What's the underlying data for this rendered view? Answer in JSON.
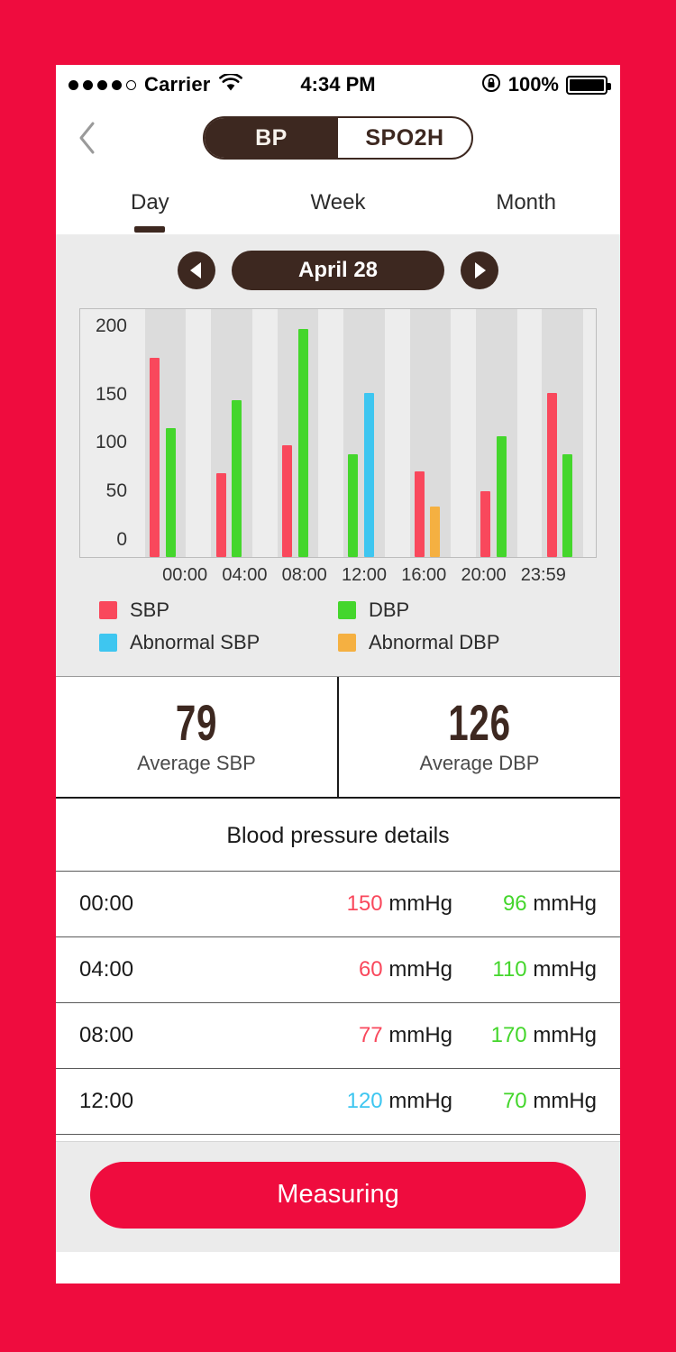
{
  "theme": {
    "frame": "#ef0c3e",
    "brown": "#3d2820",
    "sbp": "#f9485c",
    "dbp": "#44d62c",
    "abnormal_sbp": "#3ec6f0",
    "abnormal_dbp": "#f5b041"
  },
  "status_bar": {
    "carrier": "Carrier",
    "time": "4:34 PM",
    "battery_percent": "100%",
    "signal_dots_filled": 4,
    "signal_dots_total": 5,
    "wifi_icon": "wifi-icon",
    "lock_icon": "rotation-lock-icon",
    "battery_icon": "battery-full-icon"
  },
  "nav": {
    "back_icon": "chevron-left-icon",
    "segments": [
      {
        "label": "BP",
        "active": true
      },
      {
        "label": "SPO2H",
        "active": false
      }
    ]
  },
  "period_tabs": [
    {
      "label": "Day",
      "active": true
    },
    {
      "label": "Week",
      "active": false
    },
    {
      "label": "Month",
      "active": false
    }
  ],
  "date_nav": {
    "prev_icon": "arrow-left-icon",
    "next_icon": "arrow-right-icon",
    "current_date": "April 28"
  },
  "chart_data": {
    "type": "bar",
    "title": "",
    "xlabel": "",
    "ylabel": "",
    "ylim": [
      0,
      220
    ],
    "yticks": [
      0,
      50,
      100,
      150,
      200
    ],
    "grid": false,
    "legend_position": "bottom",
    "categories": [
      "00:00",
      "04:00",
      "08:00",
      "12:00",
      "16:00",
      "20:00",
      "23:59"
    ],
    "series": [
      {
        "name": "SBP",
        "color": "#f9485c",
        "values": [
          190,
          80,
          107,
          null,
          82,
          63,
          157
        ]
      },
      {
        "name": "DBP",
        "color": "#44d62c",
        "values": [
          123,
          150,
          218,
          98,
          null,
          115,
          98
        ]
      },
      {
        "name": "Abnormal  SBP",
        "color": "#3ec6f0",
        "values": [
          null,
          null,
          null,
          157,
          null,
          null,
          null
        ]
      },
      {
        "name": "Abnormal  DBP",
        "color": "#f5b041",
        "values": [
          null,
          null,
          null,
          null,
          48,
          null,
          null
        ]
      }
    ],
    "legend": [
      {
        "label": "SBP",
        "color": "#f9485c"
      },
      {
        "label": "DBP",
        "color": "#44d62c"
      },
      {
        "label": "Abnormal  SBP",
        "color": "#3ec6f0"
      },
      {
        "label": "Abnormal  DBP",
        "color": "#f5b041"
      }
    ]
  },
  "averages": [
    {
      "value": "79",
      "label": "Average SBP"
    },
    {
      "value": "126",
      "label": "Average DBP"
    }
  ],
  "details": {
    "title": "Blood pressure details",
    "unit": "mmHg",
    "rows": [
      {
        "time": "00:00",
        "sbp": "150",
        "sbp_color": "#f9485c",
        "dbp": "96",
        "dbp_color": "#44d62c"
      },
      {
        "time": "04:00",
        "sbp": "60",
        "sbp_color": "#f9485c",
        "dbp": "110",
        "dbp_color": "#44d62c"
      },
      {
        "time": "08:00",
        "sbp": "77",
        "sbp_color": "#f9485c",
        "dbp": "170",
        "dbp_color": "#44d62c"
      },
      {
        "time": "12:00",
        "sbp": "120",
        "sbp_color": "#3ec6f0",
        "dbp": "70",
        "dbp_color": "#44d62c"
      }
    ]
  },
  "footer": {
    "measure_label": "Measuring"
  }
}
